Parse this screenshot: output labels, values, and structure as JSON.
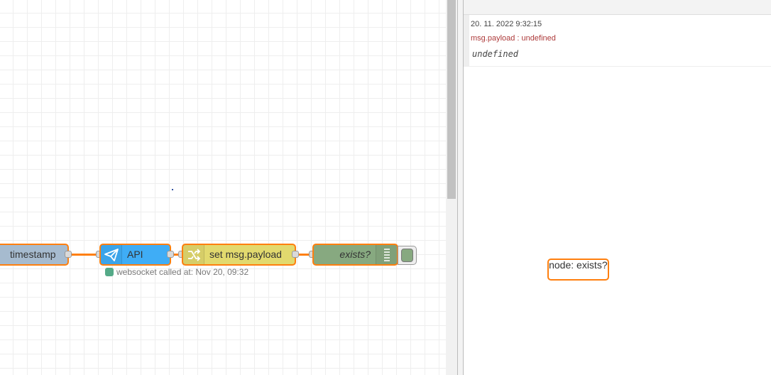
{
  "flow": {
    "nodes": {
      "timestamp": {
        "label": "timestamp"
      },
      "api": {
        "label": "API",
        "icon": "paper-plane-icon"
      },
      "change": {
        "label": "set msg.payload",
        "icon": "shuffle-icon"
      },
      "debug": {
        "label": "exists?",
        "icon": "list-lines-icon"
      }
    },
    "status": {
      "text": "websocket called at: Nov 20, 09:32",
      "color": "#55aa88"
    }
  },
  "debug": {
    "messages": [
      {
        "timestamp": "20. 11. 2022 9:32:15",
        "node": "node: exists?",
        "path": "msg.payload : undefined",
        "value": "undefined"
      }
    ]
  },
  "colors": {
    "wire": "#ff7f0e",
    "inject": "#a6bbcf",
    "websocket": "#3fadf6",
    "change": "#e2d96e",
    "debug": "#87a980"
  }
}
